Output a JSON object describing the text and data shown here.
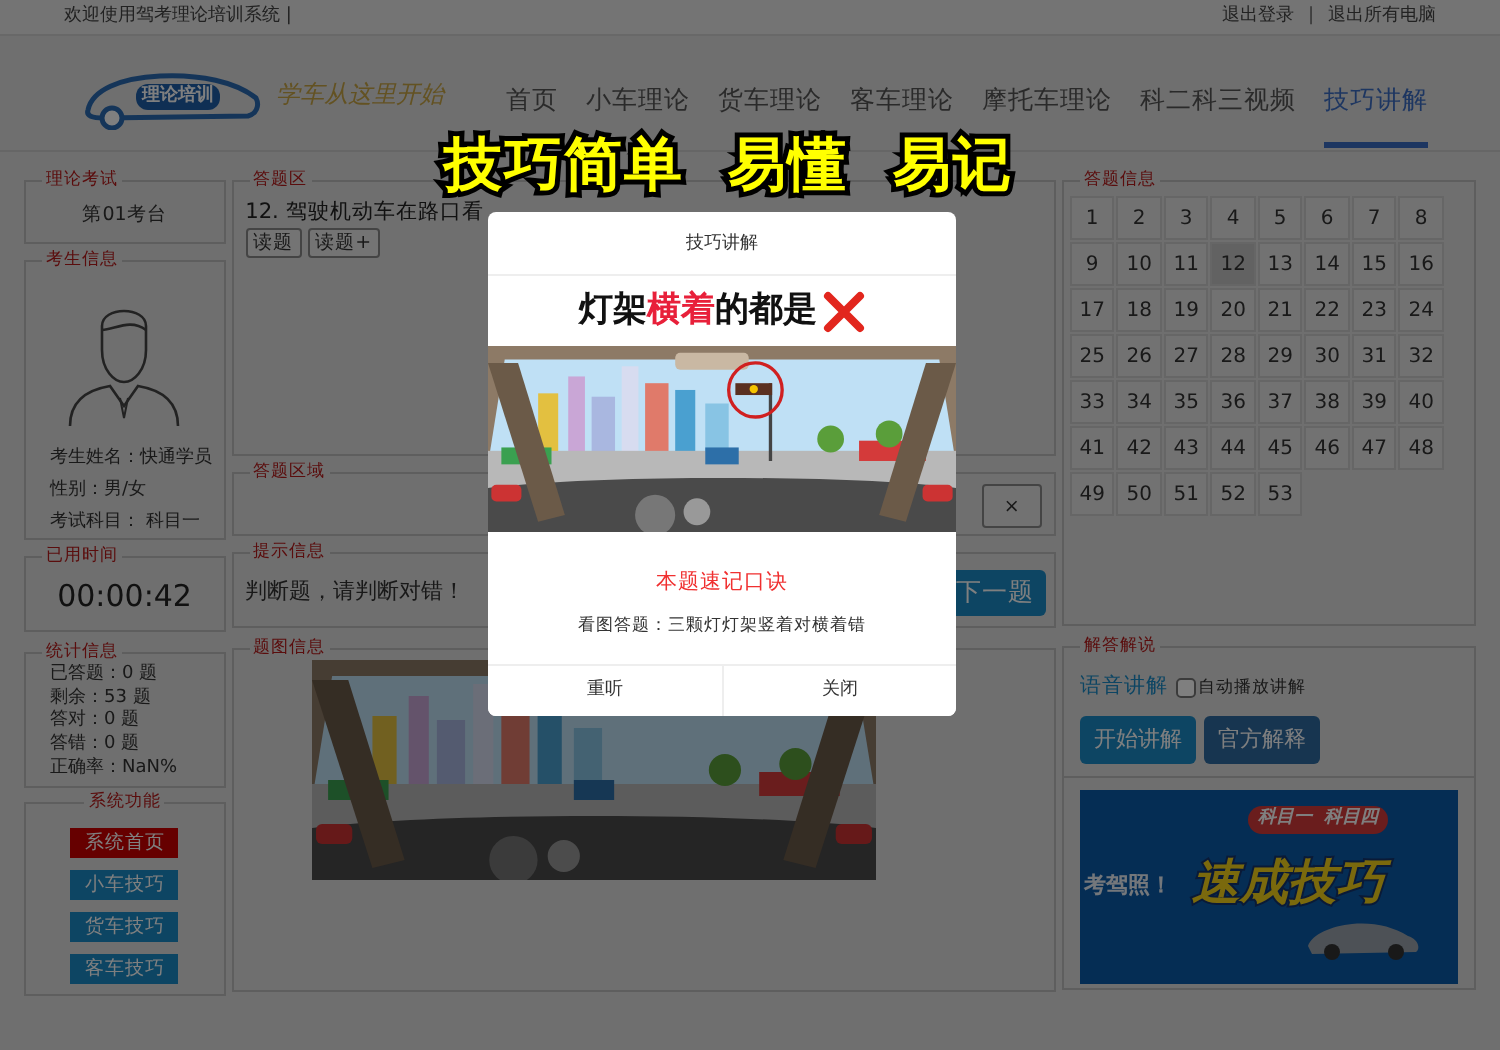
{
  "top_bar": {
    "welcome": "欢迎使用驾考理论培训系统 |",
    "links": [
      "退出登录",
      "退出所有电脑"
    ],
    "separator": "|"
  },
  "logo": {
    "badge": "理论培训",
    "slogan": "学车从这里开始"
  },
  "nav": [
    {
      "label": "首页",
      "selected": false
    },
    {
      "label": "小车理论",
      "selected": false
    },
    {
      "label": "货车理论",
      "selected": false
    },
    {
      "label": "客车理论",
      "selected": false
    },
    {
      "label": "摩托车理论",
      "selected": false
    },
    {
      "label": "科二科三视频",
      "selected": false
    },
    {
      "label": "技巧讲解",
      "selected": true
    }
  ],
  "caption": "技巧简单  易懂  易记",
  "exam_panel": {
    "title": "理论考试",
    "seat": "第01考台"
  },
  "candidate": {
    "title": "考生信息",
    "fields": [
      "考生姓名：快通学员",
      "性别：男/女",
      "考试科目： 科目一"
    ]
  },
  "timer": {
    "title": "已用时间",
    "time": "00:00:42"
  },
  "stats": {
    "title": "统计信息",
    "lines": [
      "已答题：0 题",
      "剩余：53 题",
      "答对：0 题",
      "答错：0 题",
      "正确率：NaN%"
    ]
  },
  "system": {
    "title": "系统功能",
    "buttons": [
      {
        "label": "系统首页",
        "kind": "danger"
      },
      {
        "label": "小车技巧",
        "kind": "info"
      },
      {
        "label": "货车技巧",
        "kind": "info"
      },
      {
        "label": "客车技巧",
        "kind": "info"
      }
    ]
  },
  "question_area": {
    "title": "答题区",
    "question": "12. 驾驶机动车在路口看",
    "buttons": [
      "读题",
      "读题+"
    ]
  },
  "answer_area": {
    "title": "答题区域",
    "buttons": [
      "×"
    ]
  },
  "hint": {
    "title": "提示信息",
    "text": "判断题，请判断对错！",
    "next_button": "下一题"
  },
  "image_panel": {
    "title": "题图信息"
  },
  "answer_grid": {
    "title": "答题信息",
    "numbers": [
      {
        "label": "1",
        "selected": false
      },
      {
        "label": "2",
        "selected": false
      },
      {
        "label": "3",
        "selected": false
      },
      {
        "label": "4",
        "selected": false
      },
      {
        "label": "5",
        "selected": false
      },
      {
        "label": "6",
        "selected": false
      },
      {
        "label": "7",
        "selected": false
      },
      {
        "label": "8",
        "selected": false
      },
      {
        "label": "9",
        "selected": false
      },
      {
        "label": "10",
        "selected": false
      },
      {
        "label": "11",
        "selected": false
      },
      {
        "label": "12",
        "selected": true
      },
      {
        "label": "13",
        "selected": false
      },
      {
        "label": "14",
        "selected": false
      },
      {
        "label": "15",
        "selected": false
      },
      {
        "label": "16",
        "selected": false
      },
      {
        "label": "17",
        "selected": false
      },
      {
        "label": "18",
        "selected": false
      },
      {
        "label": "19",
        "selected": false
      },
      {
        "label": "20",
        "selected": false
      },
      {
        "label": "21",
        "selected": false
      },
      {
        "label": "22",
        "selected": false
      },
      {
        "label": "23",
        "selected": false
      },
      {
        "label": "24",
        "selected": false
      },
      {
        "label": "25",
        "selected": false
      },
      {
        "label": "26",
        "selected": false
      },
      {
        "label": "27",
        "selected": false
      },
      {
        "label": "28",
        "selected": false
      },
      {
        "label": "29",
        "selected": false
      },
      {
        "label": "30",
        "selected": false
      },
      {
        "label": "31",
        "selected": false
      },
      {
        "label": "32",
        "selected": false
      },
      {
        "label": "33",
        "selected": false
      },
      {
        "label": "34",
        "selected": false
      },
      {
        "label": "35",
        "selected": false
      },
      {
        "label": "36",
        "selected": false
      },
      {
        "label": "37",
        "selected": false
      },
      {
        "label": "38",
        "selected": false
      },
      {
        "label": "39",
        "selected": false
      },
      {
        "label": "40",
        "selected": false
      },
      {
        "label": "41",
        "selected": false
      },
      {
        "label": "42",
        "selected": false
      },
      {
        "label": "43",
        "selected": false
      },
      {
        "label": "44",
        "selected": false
      },
      {
        "label": "45",
        "selected": false
      },
      {
        "label": "46",
        "selected": false
      },
      {
        "label": "47",
        "selected": false
      },
      {
        "label": "48",
        "selected": false
      },
      {
        "label": "49",
        "selected": false
      },
      {
        "label": "50",
        "selected": false
      },
      {
        "label": "51",
        "selected": false
      },
      {
        "label": "52",
        "selected": false
      },
      {
        "label": "53",
        "selected": false
      }
    ]
  },
  "explain": {
    "title": "解答解说",
    "voice_link": "语音讲解",
    "autoplay": {
      "label": "自动播放讲解",
      "checked": false
    },
    "buttons": [
      {
        "label": "开始讲解",
        "kind": "primary"
      },
      {
        "label": "官方解释",
        "kind": "secondary"
      }
    ],
    "banner": {
      "prefix": "考驾照！",
      "tag": "科目一  科目四",
      "headline": "速成技巧"
    }
  },
  "modal": {
    "title": "技巧讲解",
    "heading": [
      {
        "text": "灯架",
        "highlight": false
      },
      {
        "text": "横着",
        "highlight": true
      },
      {
        "text": "的都是",
        "highlight": false
      }
    ],
    "subtitle": "本题速记口诀",
    "tip": "看图答题：三颗灯灯架竖着对横着错",
    "buttons": [
      "重听",
      "关闭"
    ]
  }
}
